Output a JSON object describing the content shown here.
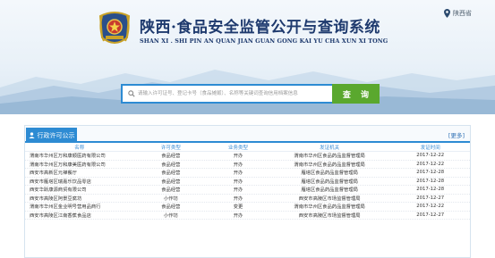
{
  "header": {
    "location": "陕西省",
    "title_cn": "陕西·食品安全监管公开与查询系统",
    "title_en": "SHAN XI . SHI PIN AN QUAN JIAN GUAN GONG KAI YU CHA XUN XI TONG"
  },
  "search": {
    "placeholder": "请输入许可证号、登记卡号（食品摊贩）、名称等关键词查询信用档案信息",
    "button_label": "查 询"
  },
  "panel": {
    "tab_label": "行政许可公示",
    "more_label": "[更多]",
    "columns": [
      "名称",
      "许可类型",
      "业务类型",
      "发证机关",
      "发证时间"
    ],
    "rows": [
      [
        "渭南市华州区万和康顺医药有限公司",
        "食品经营",
        "开办",
        "渭南市华州区食品药品监督管理局",
        "2017-12-22"
      ],
      [
        "渭南市华州区万和康美医药有限公司",
        "食品经营",
        "开办",
        "渭南市华州区食品药品监督管理局",
        "2017-12-22"
      ],
      [
        "西安市高新区元禅餐厅",
        "食品经营",
        "开办",
        "雁塔区食品药品监督管理局",
        "2017-12-28"
      ],
      [
        "西安市雁塔区瑞嘉乐饮品零店",
        "食品经营",
        "开办",
        "雁塔区食品药品监督管理局",
        "2017-12-28"
      ],
      [
        "西安华跃康源商贸有限公司",
        "食品经营",
        "开办",
        "雁塔区食品药品监督管理局",
        "2017-12-28"
      ],
      [
        "西安市高陵区阿景豆腐坊",
        "小作坊",
        "开办",
        "西安市高陵区市场监督管理局",
        "2017-12-27"
      ],
      [
        "渭南市华州区金业明号营用品商行",
        "食品经营",
        "变更",
        "渭南市华州区食品药品监督管理局",
        "2017-12-22"
      ],
      [
        "西安市高陵区江南香蕉食品店",
        "小作坊",
        "开办",
        "西安市高陵区市场监督管理局",
        "2017-12-27"
      ]
    ]
  }
}
